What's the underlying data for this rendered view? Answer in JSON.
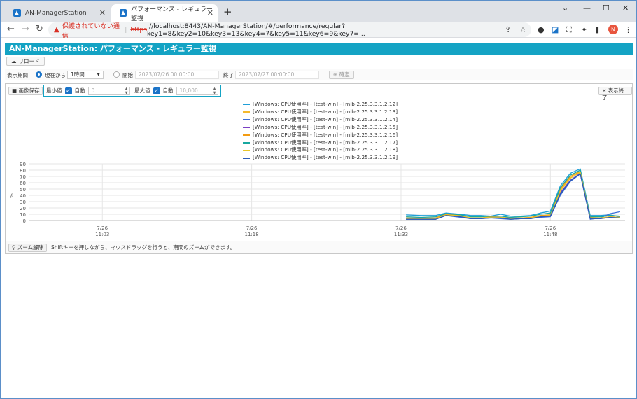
{
  "browser": {
    "tabs": [
      {
        "title": "AN-ManagerStation",
        "active": false
      },
      {
        "title": "パフォーマンス - レギュラー監視",
        "active": true
      }
    ],
    "new_tab": "+",
    "security_warning": "保護されていない通信",
    "url_scheme": "https",
    "url_rest": "://localhost:8443/AN-ManagerStation/#/performance/regular?key1=8&key2=10&key3=13&key4=7&key5=11&key6=9&key7=...",
    "avatar_letter": "N",
    "window_controls": [
      "⌄",
      "—",
      "☐",
      "✕"
    ]
  },
  "app": {
    "title": "AN-ManagerStation: パフォーマンス - レギュラー監視",
    "reload_label": "リロード",
    "period": {
      "label": "表示期間",
      "current_label": "現在から",
      "duration": "1時間",
      "start_label": "開始",
      "start_value": "2023/07/26 00:00:00",
      "end_label": "終了",
      "end_value": "2023/07/27 00:00:00",
      "confirm_label": "確定"
    },
    "panel": {
      "save_image_label": "画像保存",
      "min_label": "最小値",
      "min_auto_label": "自動",
      "min_value": "0",
      "max_label": "最大値",
      "max_auto_label": "自動",
      "max_value": "10,000",
      "close_label": "表示終了",
      "zoom_reset_label": "ズーム解除",
      "hint": "Shiftキーを押しながら、マウスドラッグを行うと、期間のズームができます。"
    }
  },
  "chart_data": {
    "type": "line",
    "ylabel": "%",
    "ylim": [
      0,
      90
    ],
    "yticks": [
      0,
      10,
      20,
      30,
      40,
      50,
      60,
      70,
      80,
      90
    ],
    "xticks": [
      {
        "date": "7/26",
        "time": "11:03",
        "t": 0
      },
      {
        "date": "7/26",
        "time": "11:18",
        "t": 15
      },
      {
        "date": "7/26",
        "time": "11:33",
        "t": 30
      },
      {
        "date": "7/26",
        "time": "11:48",
        "t": 45
      }
    ],
    "xlim": [
      -7.4,
      52.5
    ],
    "x": [
      30.5,
      32,
      33.5,
      34.5,
      36,
      37,
      38,
      39,
      40,
      41,
      42,
      43,
      44,
      45,
      46,
      47,
      48,
      49,
      50,
      51,
      52
    ],
    "series": [
      {
        "name": "[Windows: CPU使用率] - [test-win] - [mib-2.25.3.3.1.2.12]",
        "color": "#1f9fd8",
        "values": [
          9,
          8,
          8,
          12,
          10,
          8,
          8,
          7,
          10,
          7,
          7,
          8,
          12,
          15,
          55,
          75,
          82,
          8,
          8,
          9,
          6
        ]
      },
      {
        "name": "[Windows: CPU使用率] - [test-win] - [mib-2.25.3.3.1.2.13]",
        "color": "#f4b92d",
        "values": [
          4,
          3,
          4,
          10,
          8,
          4,
          4,
          6,
          5,
          3,
          4,
          5,
          7,
          9,
          48,
          68,
          76,
          4,
          3,
          5,
          4
        ]
      },
      {
        "name": "[Windows: CPU使用率] - [test-win] - [mib-2.25.3.3.1.2.14]",
        "color": "#3b6fd9",
        "values": [
          2,
          2,
          2,
          8,
          5,
          3,
          3,
          4,
          3,
          2,
          3,
          3,
          5,
          6,
          40,
          62,
          74,
          2,
          4,
          11,
          14
        ]
      },
      {
        "name": "[Windows: CPU使用率] - [test-win] - [mib-2.25.3.3.1.2.15]",
        "color": "#7a3fc4",
        "values": [
          3,
          3,
          3,
          9,
          6,
          3,
          3,
          5,
          4,
          3,
          3,
          4,
          6,
          7,
          44,
          64,
          75,
          3,
          3,
          6,
          5
        ]
      },
      {
        "name": "[Windows: CPU使用率] - [test-win] - [mib-2.25.3.3.1.2.16]",
        "color": "#f39c12",
        "values": [
          4,
          4,
          4,
          10,
          7,
          4,
          4,
          6,
          5,
          4,
          4,
          5,
          8,
          9,
          50,
          70,
          78,
          5,
          4,
          6,
          5
        ]
      },
      {
        "name": "[Windows: CPU使用率] - [test-win] - [mib-2.25.3.3.1.2.17]",
        "color": "#17a8a0",
        "values": [
          6,
          5,
          6,
          11,
          9,
          6,
          6,
          7,
          7,
          5,
          6,
          7,
          10,
          12,
          52,
          72,
          80,
          6,
          6,
          8,
          7
        ]
      },
      {
        "name": "[Windows: CPU使用率] - [test-win] - [mib-2.25.3.3.1.2.18]",
        "color": "#e8c62a",
        "values": [
          3,
          3,
          3,
          9,
          7,
          4,
          4,
          5,
          5,
          3,
          4,
          4,
          7,
          8,
          47,
          67,
          77,
          4,
          4,
          6,
          5
        ]
      },
      {
        "name": "[Windows: CPU使用率] - [test-win] - [mib-2.25.3.3.1.2.19]",
        "color": "#2b5bb8",
        "values": [
          2,
          2,
          2,
          8,
          6,
          3,
          3,
          4,
          4,
          2,
          3,
          3,
          6,
          7,
          42,
          63,
          74,
          3,
          3,
          5,
          4
        ]
      }
    ]
  }
}
